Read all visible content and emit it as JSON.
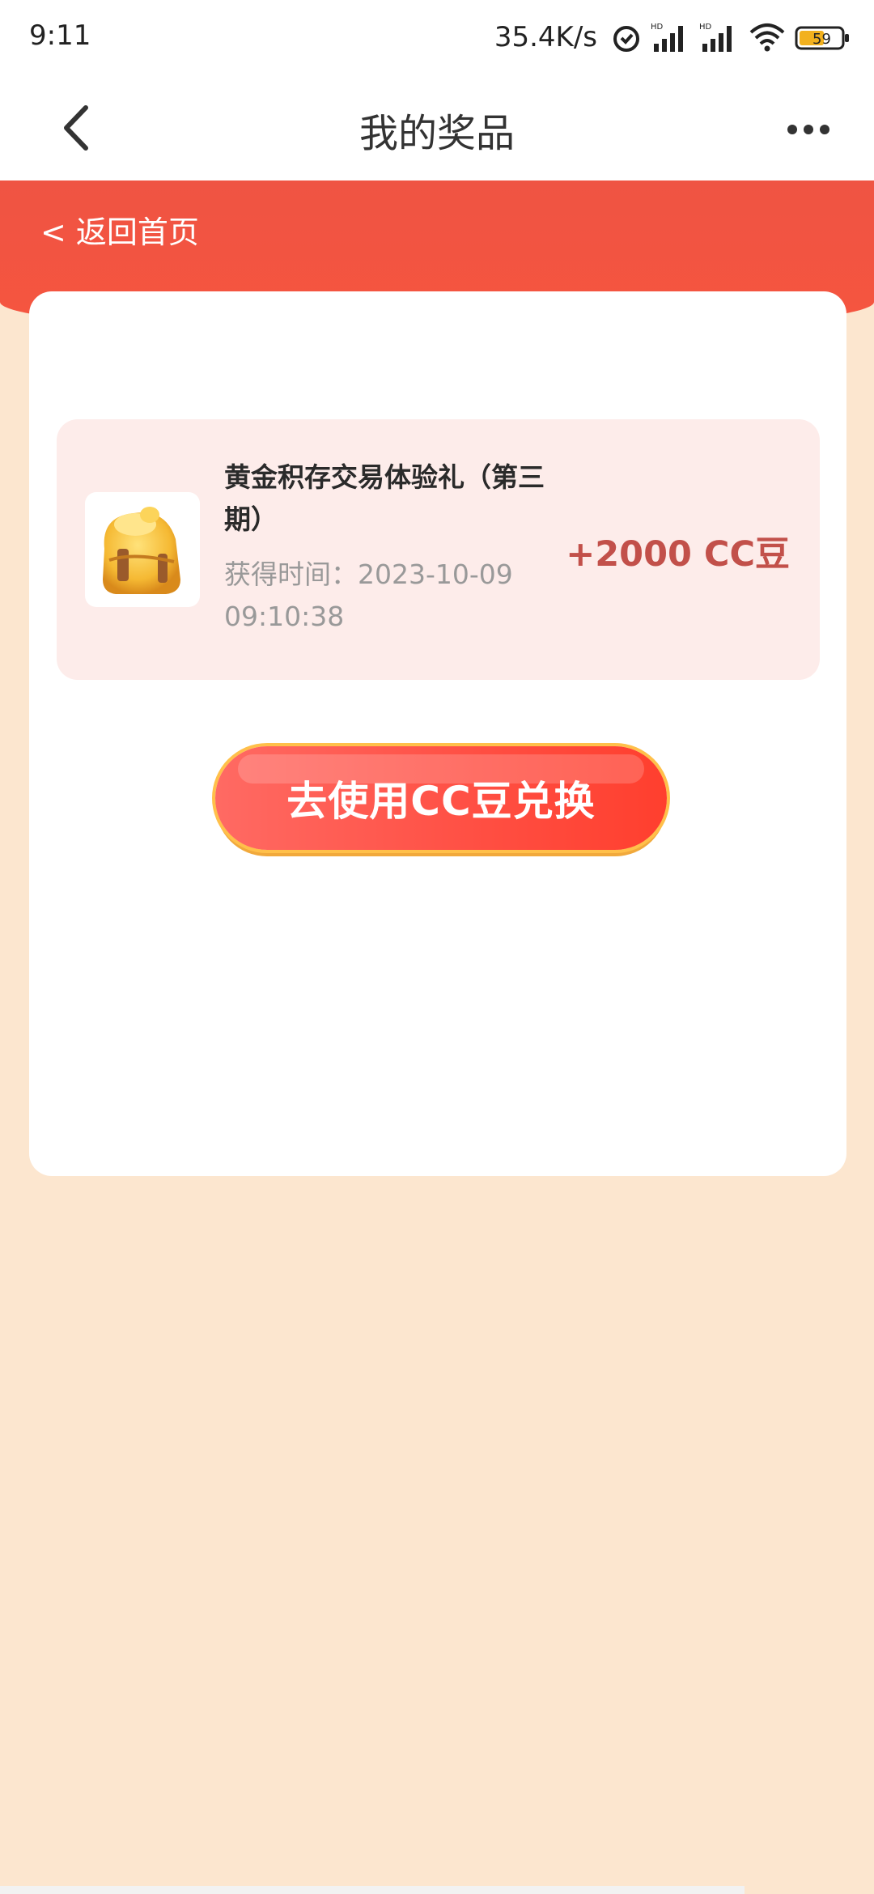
{
  "status_bar": {
    "time": "9:11",
    "network_speed": "35.4K/s",
    "battery": "59",
    "icons": [
      "alarm-icon",
      "signal-hd-icon",
      "signal-hd-icon",
      "wifi-icon",
      "battery-icon"
    ]
  },
  "header": {
    "title": "我的奖品",
    "back_icon": "chevron-left-icon",
    "more_icon": "more-dots-icon"
  },
  "banner": {
    "back_home": "< 返回首页"
  },
  "prize": {
    "title": "黄金积存交易体验礼（第三期）",
    "time": "获得时间：2023-10-09 09:10:38",
    "amount": "+2000 CC豆",
    "image_icon": "golden-backpack-icon"
  },
  "action": {
    "button_label": "去使用CC豆兑换"
  },
  "colors": {
    "header_red": "#F6553F",
    "page_bg": "#FCE6CF",
    "amount": "#C2504A",
    "prize_row_bg": "#FDECEA"
  }
}
